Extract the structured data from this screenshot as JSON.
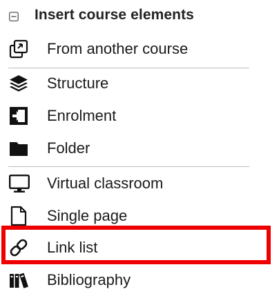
{
  "header": {
    "title": "Insert course elements",
    "toggle_icon": "minus-square-icon"
  },
  "items": [
    {
      "label": "From another course",
      "icon": "copy-icon"
    },
    {
      "label": "Structure",
      "icon": "layers-icon"
    },
    {
      "label": "Enrolment",
      "icon": "sign-in-icon"
    },
    {
      "label": "Folder",
      "icon": "folder-icon"
    },
    {
      "label": "Virtual classroom",
      "icon": "monitor-icon"
    },
    {
      "label": "Single page",
      "icon": "file-icon"
    },
    {
      "label": "Link list",
      "icon": "link-icon"
    },
    {
      "label": "Bibliography",
      "icon": "books-icon"
    }
  ],
  "colors": {
    "highlight": "#ee0000",
    "divider": "#bdbdbd",
    "text": "#1a1a1a"
  }
}
